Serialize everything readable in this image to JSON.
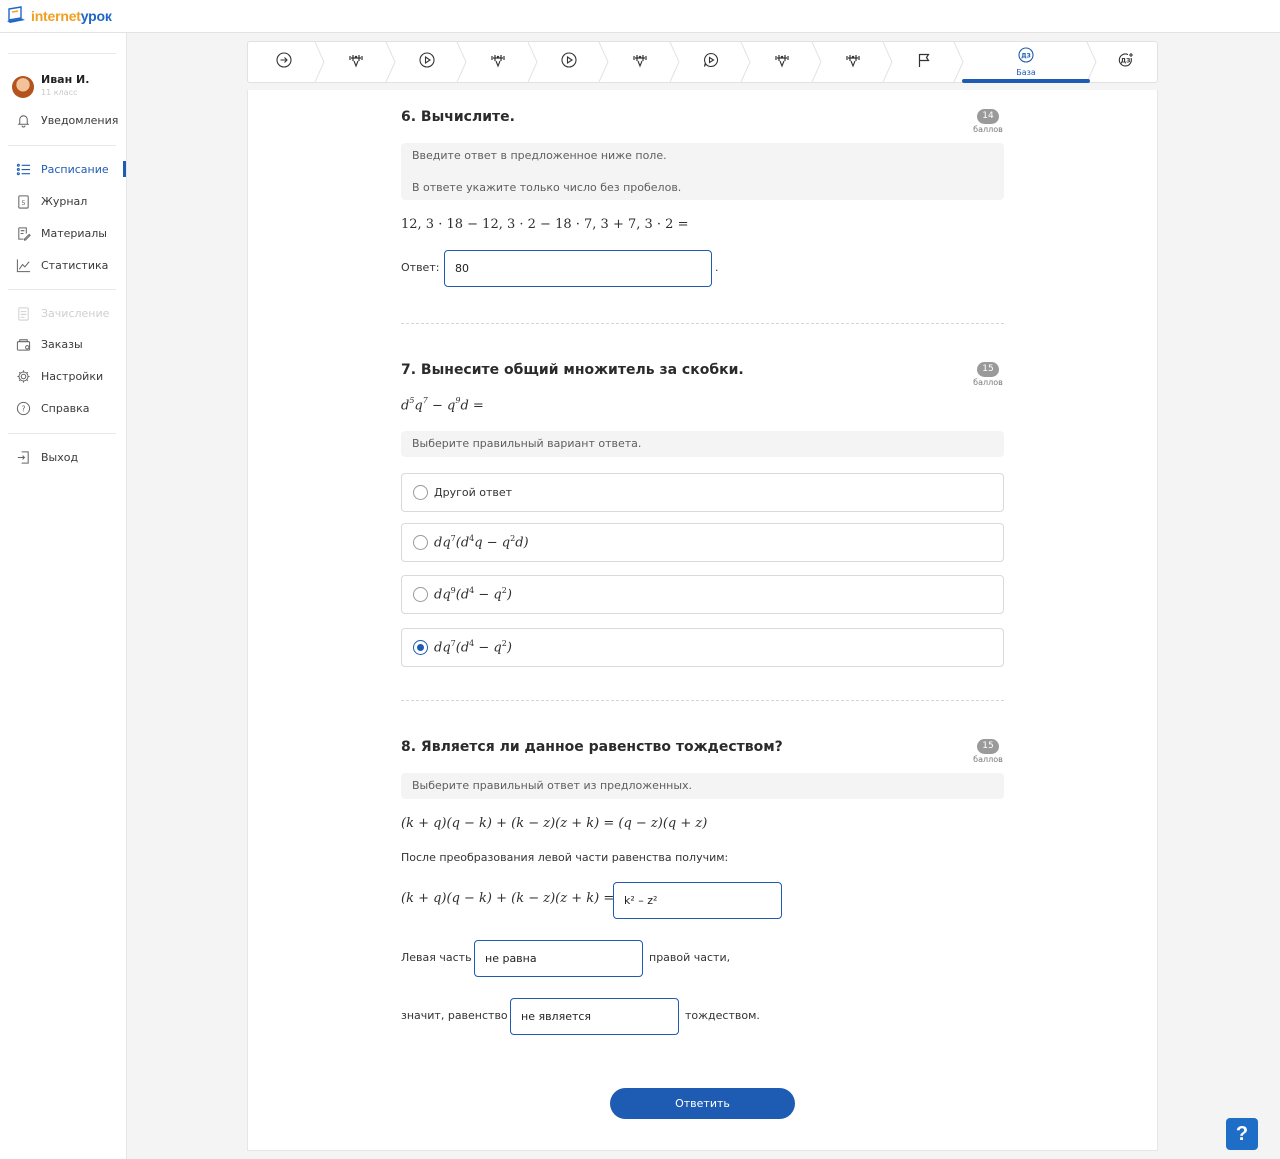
{
  "brand": {
    "part1": "internet",
    "part2": "урок"
  },
  "user": {
    "name": "Иван И.",
    "grade": "11 класс"
  },
  "sidebar": {
    "items": [
      {
        "label": "Уведомления",
        "icon": "bell-icon"
      },
      {
        "label": "Расписание",
        "icon": "schedule-list-icon",
        "active": true
      },
      {
        "label": "Журнал",
        "icon": "journal-icon"
      },
      {
        "label": "Материалы",
        "icon": "materials-icon"
      },
      {
        "label": "Статистика",
        "icon": "chart-icon"
      },
      {
        "label": "Зачисление",
        "icon": "enrollment-icon",
        "disabled": true
      },
      {
        "label": "Заказы",
        "icon": "orders-icon"
      },
      {
        "label": "Настройки",
        "icon": "gear-icon"
      },
      {
        "label": "Справка",
        "icon": "help-icon"
      },
      {
        "label": "Выход",
        "icon": "logout-icon"
      }
    ]
  },
  "steps": {
    "icons": [
      "arrow-right-circle-icon",
      "workout-icon",
      "play-circle-icon",
      "workout-icon",
      "play-circle-icon",
      "workout-icon",
      "chat-play-icon",
      "workout-icon",
      "workout-icon",
      "flag-icon",
      "homework-icon",
      "homework-plus-icon"
    ],
    "current_label": "База",
    "homework_badge": "ДЗ"
  },
  "q6": {
    "title": "6. Вычислите.",
    "score": "14",
    "score_label": "баллов",
    "hint1": "Введите ответ в предложенное ниже поле.",
    "hint2": "В ответе укажите только число без пробелов.",
    "expression": "12, 3 · 18 − 12, 3 · 2 − 18 · 7, 3 + 7, 3 · 2 =",
    "answer_label": "Ответ:",
    "answer_value": "80",
    "answer_suffix": "."
  },
  "q7": {
    "title": "7. Вынесите общий множитель за скобки.",
    "score": "15",
    "score_label": "баллов",
    "hint": "Выберите правильный вариант ответа.",
    "options": [
      "Другой ответ",
      "dq⁷(d⁴q − q²d)",
      "dq⁹(d⁴ − q²)",
      "dq⁷(d⁴ − q²)"
    ],
    "selected_index": 3
  },
  "q8": {
    "title": "8. Является ли данное равенство тождеством?",
    "score": "15",
    "score_label": "баллов",
    "hint": "Выберите правильный ответ из предложенных.",
    "equation": "(k + q)(q − k) + (k − z)(z + k) = (q − z)(q + z)",
    "transform_text": "После преобразования левой части равенства получим:",
    "left_side": "(k + q)(q − k) + (k − z)(z + k) =",
    "fill1": "k² – z²",
    "line2_pre": "Левая часть",
    "fill2": "не равна",
    "line2_post": "правой части,",
    "line3_pre": "значит, равенство",
    "fill3": "не является",
    "line3_post": "тождеством."
  },
  "submit_label": "Ответить",
  "help_label": "?",
  "colors": {
    "accent": "#1e5cb3",
    "brand_orange": "#f0a020",
    "brand_blue": "#1f66c6"
  }
}
